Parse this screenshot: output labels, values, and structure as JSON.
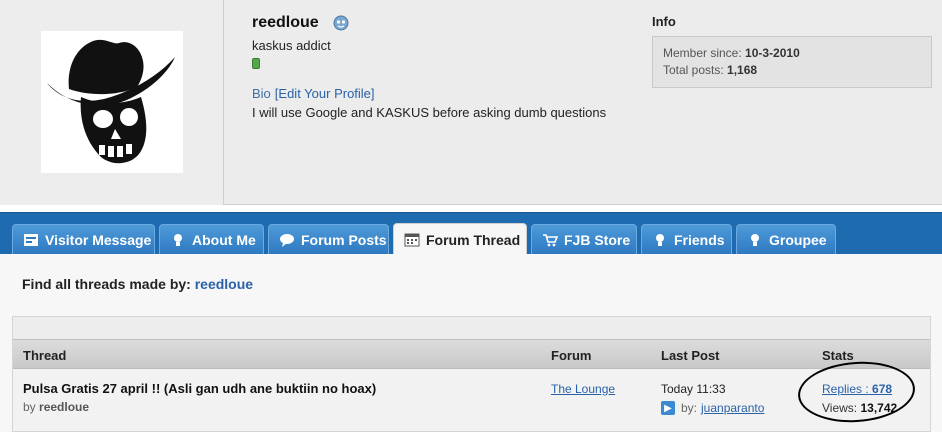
{
  "profile": {
    "username": "reedloue",
    "user_title": "kaskus addict",
    "bio_label": "Bio",
    "bio_edit_link": "[Edit Your Profile]",
    "bio_text": "I will use Google and KASKUS before asking dumb questions"
  },
  "info": {
    "title": "Info",
    "member_since_label": "Member since:",
    "member_since_value": "10-3-2010",
    "total_posts_label": "Total posts:",
    "total_posts_value": "1,168"
  },
  "tabs": [
    {
      "label": "Visitor Message",
      "icon": "message-icon"
    },
    {
      "label": "About Me",
      "icon": "person-icon"
    },
    {
      "label": "Forum Posts",
      "icon": "speech-bubble-icon"
    },
    {
      "label": "Forum Thread",
      "icon": "calendar-icon",
      "active": true
    },
    {
      "label": "FJB Store",
      "icon": "cart-icon"
    },
    {
      "label": "Friends",
      "icon": "friend-icon"
    },
    {
      "label": "Groupee",
      "icon": "group-icon"
    }
  ],
  "content": {
    "find_label": "Find all threads made by:",
    "find_user": "reedloue"
  },
  "table": {
    "headers": {
      "thread": "Thread",
      "forum": "Forum",
      "last_post": "Last Post",
      "stats": "Stats"
    },
    "rows": [
      {
        "title": "Pulsa Gratis 27 april !! (Asli gan udh ane buktiin no hoax)",
        "by_label": "by",
        "author": "reedloue",
        "forum": "The Lounge",
        "last_post_time": "Today 11:33",
        "last_post_by_label": "by:",
        "last_post_user": "juanparanto",
        "replies_label": "Replies :",
        "replies_value": "678",
        "views_label": "Views:",
        "views_value": "13,742"
      }
    ]
  },
  "colors": {
    "tab_bar": "#1f6bb0",
    "link": "#2a62a8",
    "online": "#55a84a"
  }
}
